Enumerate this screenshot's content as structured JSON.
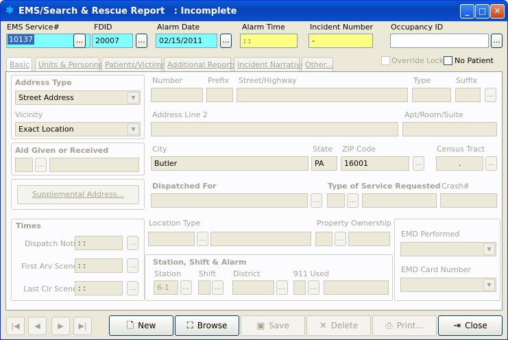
{
  "window": {
    "title": "EMS/Search & Rescue Report   : Incomplete",
    "minimize": "_",
    "maximize": "□",
    "close": "✕"
  },
  "header": {
    "ems_service_label": "EMS Service#",
    "ems_service_value": "10137",
    "fdid_label": "FDID",
    "fdid_value": "20007",
    "alarm_date_label": "Alarm Date",
    "alarm_date_value": "02/15/2011",
    "alarm_time_label": "Alarm Time",
    "alarm_time_value": " :  :",
    "incident_number_label": "Incident Number",
    "incident_number_value": "-",
    "occupancy_label": "Occupancy ID",
    "occupancy_value": "",
    "override_lock_label": "Override Lock",
    "no_patient_label": "No Patient",
    "lookup_button": "..."
  },
  "tabs": [
    {
      "label": "Basic"
    },
    {
      "label": "Units & Personnel"
    },
    {
      "label": "Patients/Victims"
    },
    {
      "label": "Additional Reports"
    },
    {
      "label": "Incident Narrative"
    },
    {
      "label": "Other..."
    }
  ],
  "address": {
    "address_type_label": "Address Type",
    "address_type_value": "Street Address",
    "vicinity_label": "Vicinity",
    "vicinity_value": "Exact Location",
    "aid_label": "Aid Given or Received",
    "supplemental_button": "Supplemental Address...",
    "number_label": "Number",
    "prefix_label": "Prefix",
    "street_label": "Street/Highway",
    "type_label": "Type",
    "suffix_label": "Suffix",
    "address2_label": "Address Line 2",
    "apt_label": "Apt/Room/Suite",
    "city_label": "City",
    "city_value": "Butler",
    "state_label": "State",
    "state_value": "PA",
    "zip_label": "ZIP Code",
    "zip_value": "16001",
    "census_label": "Census Tract",
    "census_value": ".",
    "dispatched_label": "Dispatched For",
    "service_label": "Type of Service Requested",
    "crash_label": "Crash#"
  },
  "times": {
    "title": "Times",
    "dispatch_label": "Dispatch Notif",
    "first_arv_label": "First Arv Scene",
    "last_clr_label": "Last Clr Scene",
    "time_value": " :  :"
  },
  "location": {
    "location_type_label": "Location Type",
    "property_label": "Property Ownership"
  },
  "station": {
    "title": "Station, Shift & Alarm",
    "station_label": "Station",
    "station_value": "6-1",
    "shift_label": "Shift",
    "district_label": "District",
    "used_911_label": "911 Used"
  },
  "emd": {
    "performed_label": "EMD Performed",
    "card_label": "EMD Card Number"
  },
  "toolbar": {
    "new": "New",
    "browse": "Browse",
    "save": "Save",
    "delete": "Delete",
    "print": "Print...",
    "close": "Close"
  },
  "nav": {
    "first": "|◀",
    "prev": "◀",
    "next": "▶",
    "last": "▶|"
  }
}
